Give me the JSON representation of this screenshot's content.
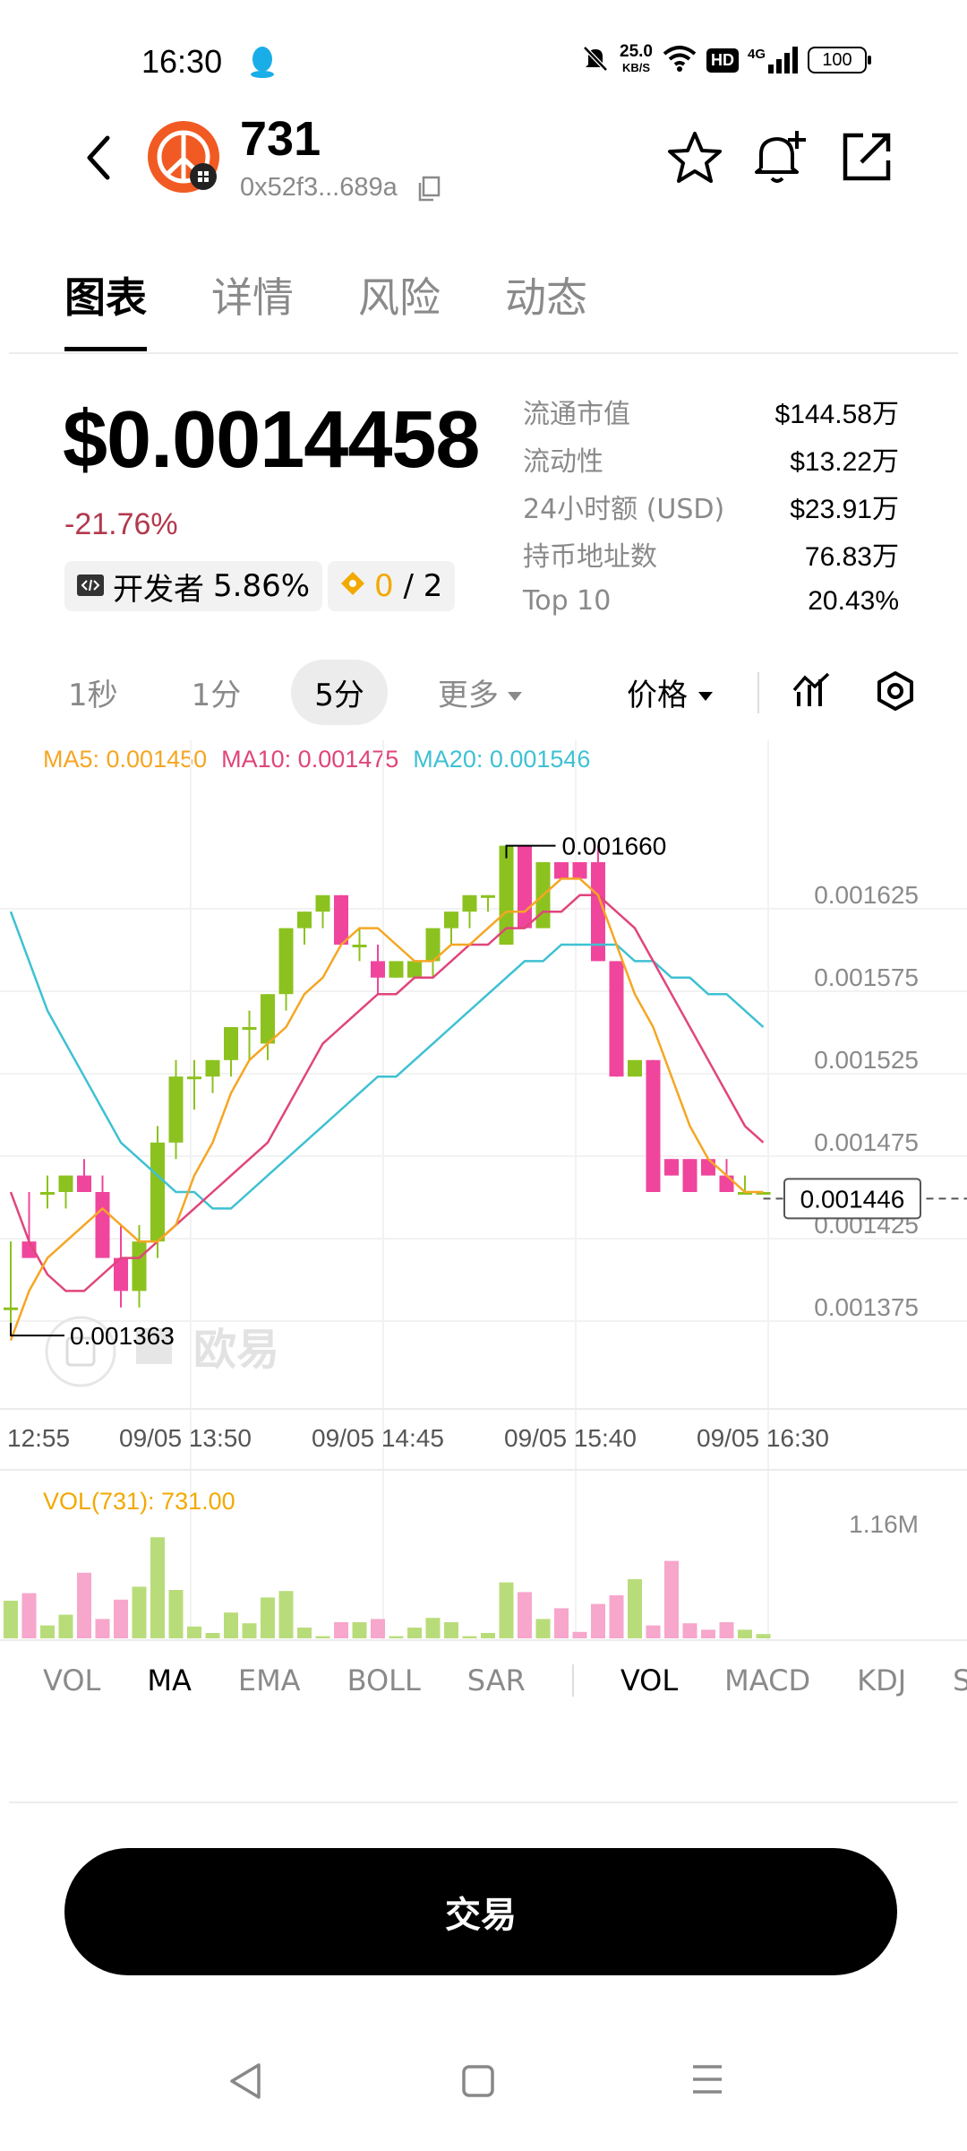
{
  "status_bar": {
    "time": "16:30",
    "speed_value": "25.0",
    "speed_unit": "KB/S",
    "hd": "HD",
    "network": "4G",
    "battery": "100"
  },
  "token": {
    "name": "731",
    "address": "0x52f3...689a"
  },
  "tabs": [
    {
      "label": "图表",
      "active": true
    },
    {
      "label": "详情",
      "active": false
    },
    {
      "label": "风险",
      "active": false
    },
    {
      "label": "动态",
      "active": false
    }
  ],
  "price": {
    "value": "$0.0014458",
    "change": "-21.76%"
  },
  "chips": {
    "dev_label": "开发者",
    "dev_value": "5.86%",
    "holders_current": "0",
    "holders_total": "/ 2"
  },
  "stats": [
    {
      "label": "流通市值",
      "value": "$144.58万"
    },
    {
      "label": "流动性",
      "value": "$13.22万"
    },
    {
      "label": "24小时额 (USD)",
      "value": "$23.91万"
    },
    {
      "label": "持币地址数",
      "value": "76.83万"
    },
    {
      "label": "Top 10",
      "value": "20.43%"
    }
  ],
  "intervals": [
    {
      "label": "1秒",
      "active": false
    },
    {
      "label": "1分",
      "active": false
    },
    {
      "label": "5分",
      "active": true
    }
  ],
  "more_label": "更多",
  "price_type_label": "价格",
  "ma_legend": {
    "ma5": "MA5: 0.001450",
    "ma10": "MA10: 0.001475",
    "ma20": "MA20: 0.001546"
  },
  "colors": {
    "up": "#8cc21f",
    "down": "#f0459d",
    "ma5": "#f5a623",
    "ma10": "#e0457b",
    "ma20": "#3ec1d3",
    "accent": "#f2a900"
  },
  "chart_data": {
    "type": "candlestick",
    "y_ticks": [
      "0.001625",
      "0.001575",
      "0.001525",
      "0.001475",
      "0.001425",
      "0.001375"
    ],
    "y_tick_values": [
      0.001625,
      0.001575,
      0.001525,
      0.001475,
      0.001425,
      0.001375
    ],
    "x_ticks": [
      "12:55",
      "09/05 13:50",
      "09/05 14:45",
      "09/05 15:40",
      "09/05 16:30"
    ],
    "ylim": [
      0.001345,
      0.001705
    ],
    "high_label": "0.001660",
    "low_label": "0.001363",
    "current_label": "0.001446",
    "current_value": 0.001446,
    "high_value": 0.00166,
    "low_value": 0.001363,
    "candles": [
      [
        0.00138,
        0.00142,
        0.00137,
        0.00138
      ],
      [
        0.00142,
        0.00145,
        0.00141,
        0.00141
      ],
      [
        0.00145,
        0.00146,
        0.00144,
        0.00145
      ],
      [
        0.00145,
        0.00146,
        0.00144,
        0.00146
      ],
      [
        0.00146,
        0.00147,
        0.00145,
        0.00145
      ],
      [
        0.00145,
        0.00146,
        0.00141,
        0.00141
      ],
      [
        0.00141,
        0.00143,
        0.00138,
        0.00139
      ],
      [
        0.00139,
        0.00143,
        0.00138,
        0.00142
      ],
      [
        0.00142,
        0.00149,
        0.00141,
        0.00148
      ],
      [
        0.00148,
        0.00153,
        0.00147,
        0.00152
      ],
      [
        0.00152,
        0.00153,
        0.0015,
        0.00152
      ],
      [
        0.00152,
        0.00153,
        0.00151,
        0.00153
      ],
      [
        0.00153,
        0.00155,
        0.00152,
        0.00155
      ],
      [
        0.00155,
        0.00156,
        0.00153,
        0.00155
      ],
      [
        0.00154,
        0.00157,
        0.00153,
        0.00157
      ],
      [
        0.00157,
        0.00161,
        0.00156,
        0.00161
      ],
      [
        0.00161,
        0.00162,
        0.0016,
        0.00162
      ],
      [
        0.00162,
        0.00163,
        0.00161,
        0.00163
      ],
      [
        0.00163,
        0.00163,
        0.0016,
        0.0016
      ],
      [
        0.0016,
        0.00161,
        0.00159,
        0.0016
      ],
      [
        0.00159,
        0.0016,
        0.00157,
        0.00158
      ],
      [
        0.00158,
        0.00159,
        0.00158,
        0.00159
      ],
      [
        0.00158,
        0.00159,
        0.00158,
        0.00159
      ],
      [
        0.00159,
        0.00161,
        0.00158,
        0.00161
      ],
      [
        0.00161,
        0.00162,
        0.0016,
        0.00162
      ],
      [
        0.00162,
        0.00163,
        0.00161,
        0.00163
      ],
      [
        0.00163,
        0.00163,
        0.00162,
        0.00163
      ],
      [
        0.0016,
        0.00166,
        0.0016,
        0.00166
      ],
      [
        0.00166,
        0.00166,
        0.00161,
        0.00161
      ],
      [
        0.00161,
        0.00165,
        0.00161,
        0.00165
      ],
      [
        0.00165,
        0.00165,
        0.00164,
        0.00164
      ],
      [
        0.00165,
        0.00165,
        0.00164,
        0.00164
      ],
      [
        0.00165,
        0.00166,
        0.00159,
        0.00159
      ],
      [
        0.00159,
        0.00159,
        0.00152,
        0.00152
      ],
      [
        0.00152,
        0.00153,
        0.00152,
        0.00153
      ],
      [
        0.00153,
        0.00153,
        0.00145,
        0.00145
      ],
      [
        0.00147,
        0.00147,
        0.00146,
        0.00146
      ],
      [
        0.00147,
        0.00147,
        0.00145,
        0.00145
      ],
      [
        0.00147,
        0.00147,
        0.00146,
        0.00146
      ],
      [
        0.00146,
        0.00147,
        0.00145,
        0.00145
      ],
      [
        0.00145,
        0.00146,
        0.00145,
        0.00145
      ],
      [
        0.00145,
        0.00145,
        0.00145,
        0.00145
      ]
    ],
    "ma5": [
      0.00136,
      0.00139,
      0.00141,
      0.00142,
      0.00143,
      0.00144,
      0.00143,
      0.00142,
      0.00142,
      0.00143,
      0.00146,
      0.00148,
      0.00151,
      0.00153,
      0.00154,
      0.00155,
      0.00157,
      0.00158,
      0.0016,
      0.00161,
      0.00161,
      0.0016,
      0.00159,
      0.00159,
      0.0016,
      0.0016,
      0.00161,
      0.00162,
      0.00162,
      0.00163,
      0.00164,
      0.00164,
      0.00163,
      0.0016,
      0.00157,
      0.00155,
      0.00152,
      0.00149,
      0.00147,
      0.00146,
      0.00145,
      0.00145
    ],
    "ma10": [
      0.00145,
      0.00142,
      0.0014,
      0.00139,
      0.00139,
      0.0014,
      0.00141,
      0.00141,
      0.00142,
      0.00143,
      0.00144,
      0.00145,
      0.00146,
      0.00147,
      0.00148,
      0.0015,
      0.00152,
      0.00154,
      0.00155,
      0.00156,
      0.00157,
      0.00157,
      0.00158,
      0.00158,
      0.00159,
      0.0016,
      0.0016,
      0.00161,
      0.00161,
      0.00162,
      0.00162,
      0.00163,
      0.00163,
      0.00162,
      0.00161,
      0.00159,
      0.00157,
      0.00155,
      0.00153,
      0.00151,
      0.00149,
      0.00148
    ],
    "ma20": [
      0.00162,
      0.00159,
      0.00156,
      0.00154,
      0.00152,
      0.0015,
      0.00148,
      0.00147,
      0.00146,
      0.00145,
      0.00145,
      0.00144,
      0.00144,
      0.00145,
      0.00146,
      0.00147,
      0.00148,
      0.00149,
      0.0015,
      0.00151,
      0.00152,
      0.00152,
      0.00153,
      0.00154,
      0.00155,
      0.00156,
      0.00157,
      0.00158,
      0.00159,
      0.00159,
      0.0016,
      0.0016,
      0.0016,
      0.0016,
      0.00159,
      0.00159,
      0.00158,
      0.00158,
      0.00157,
      0.00157,
      0.00156,
      0.00155
    ],
    "volume_label": "VOL(731): 731.00",
    "volume_axis_label": "1.16M",
    "volume_max": 1.16,
    "volumes": [
      0.35,
      0.42,
      0.12,
      0.22,
      0.61,
      0.18,
      0.36,
      0.48,
      0.94,
      0.45,
      0.11,
      0.05,
      0.24,
      0.14,
      0.38,
      0.44,
      0.1,
      0.02,
      0.15,
      0.15,
      0.18,
      0.02,
      0.1,
      0.19,
      0.15,
      0.02,
      0.05,
      0.52,
      0.43,
      0.18,
      0.28,
      0.06,
      0.32,
      0.4,
      0.55,
      0.12,
      0.72,
      0.14,
      0.08,
      0.15,
      0.08,
      0.04
    ]
  },
  "watermark": "欧易",
  "indicator_tabs_main": [
    "VOL",
    "MA",
    "EMA",
    "BOLL",
    "SAR"
  ],
  "indicator_tabs_sub": [
    "VOL",
    "MACD",
    "KDJ",
    "S"
  ],
  "trade_button": "交易"
}
